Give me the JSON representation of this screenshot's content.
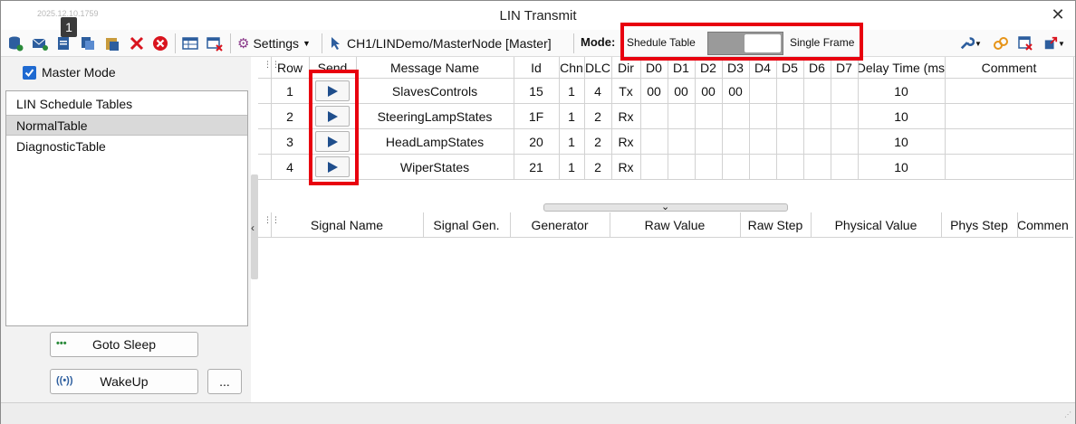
{
  "window": {
    "title": "LIN Transmit",
    "timestamp": "2025.12.10.1759",
    "badge": "1"
  },
  "toolbar": {
    "settings_label": "Settings",
    "path": "CH1/LINDemo/MasterNode [Master]",
    "mode_label": "Mode:",
    "mode_left": "Shedule Table",
    "mode_right": "Single Frame",
    "mode_value": "Single Frame",
    "icons": [
      "database-add-icon",
      "mail-icon",
      "document-icon",
      "copy-icon",
      "paste-icon",
      "delete-icon",
      "cancel-icon",
      "table-icon",
      "table-remove-icon",
      "gear-icon",
      "pointer-icon",
      "wrench-icon",
      "link-icon",
      "window-close-icon",
      "export-icon"
    ]
  },
  "left": {
    "master_mode": "Master Mode",
    "tree": [
      "LIN Schedule Tables",
      "NormalTable",
      "DiagnosticTable"
    ],
    "goto_sleep": "Goto Sleep",
    "wakeup": "WakeUp",
    "more": "..."
  },
  "messages": {
    "columns": [
      "Row",
      "Send",
      "Message Name",
      "Id",
      "Chn",
      "DLC",
      "Dir",
      "D0",
      "D1",
      "D2",
      "D3",
      "D4",
      "D5",
      "D6",
      "D7",
      "Delay Time (ms",
      "Comment"
    ],
    "rows": [
      {
        "row": "1",
        "name": "SlavesControls",
        "id": "15",
        "chn": "1",
        "dlc": "4",
        "dir": "Tx",
        "d0": "00",
        "d1": "00",
        "d2": "00",
        "d3": "00",
        "delay": "10"
      },
      {
        "row": "2",
        "name": "SteeringLampStates",
        "id": "1F",
        "chn": "1",
        "dlc": "2",
        "dir": "Rx",
        "d0": "",
        "d1": "",
        "d2": "",
        "d3": "",
        "delay": "10"
      },
      {
        "row": "3",
        "name": "HeadLampStates",
        "id": "20",
        "chn": "1",
        "dlc": "2",
        "dir": "Rx",
        "d0": "",
        "d1": "",
        "d2": "",
        "d3": "",
        "delay": "10"
      },
      {
        "row": "4",
        "name": "WiperStates",
        "id": "21",
        "chn": "1",
        "dlc": "2",
        "dir": "Rx",
        "d0": "",
        "d1": "",
        "d2": "",
        "d3": "",
        "delay": "10"
      }
    ]
  },
  "signals": {
    "columns": [
      "Signal Name",
      "Signal Gen.",
      "Generator",
      "Raw Value",
      "Raw Step",
      "Physical Value",
      "Phys Step",
      "Commen"
    ]
  },
  "colors": {
    "highlight": "#e8000f",
    "play": "#1f4e8c",
    "checkbox": "#1f6ad1"
  }
}
